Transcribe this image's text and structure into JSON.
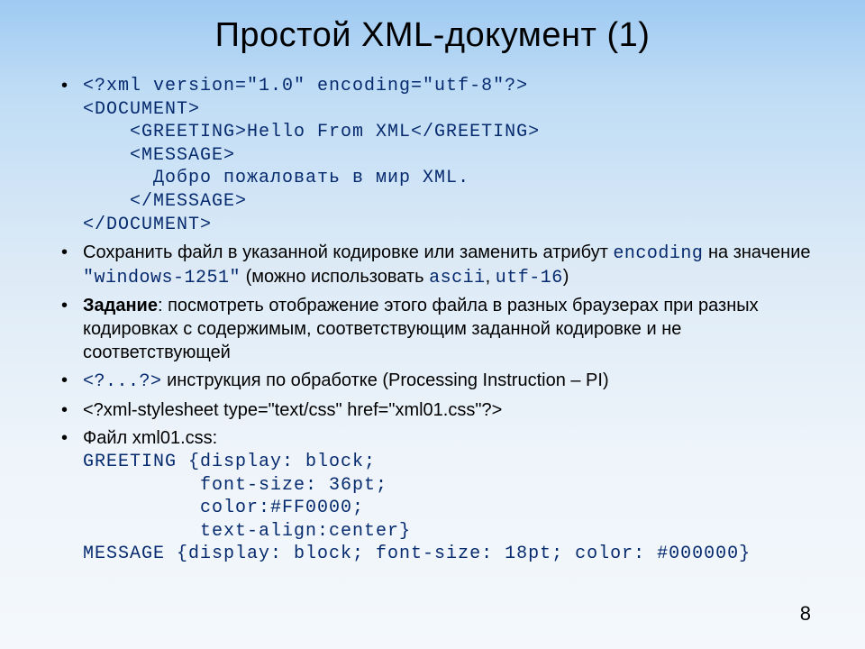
{
  "title": "Простой XML-документ (1)",
  "page_number": "8",
  "bullets": {
    "b1_code": "<?xml version=\"1.0\" encoding=\"utf-8\"?>\n<DOCUMENT>\n    <GREETING>Hello From XML</GREETING>\n    <MESSAGE>\n      Добро пожаловать в мир XML.\n    </MESSAGE>\n</DOCUMENT>",
    "b2_pre": "Сохранить файл в указанной кодировке или заменить атрибут ",
    "b2_code1": "encoding",
    "b2_mid": " на значение ",
    "b2_code2": "\"windows-1251\"",
    "b2_mid2": " (можно использовать ",
    "b2_code3": "ascii",
    "b2_sep": ", ",
    "b2_code4": "utf-16",
    "b2_post": ")",
    "b3_label": "Задание",
    "b3_text": ": посмотреть отображение этого файла в разных браузерах при разных кодировках с содержимым, соответствующим заданной кодировке и не соответствующей",
    "b4_code": "<?...?>",
    "b4_text": " инструкция по обработке (Processing Instruction – PI)",
    "b5_text": "<?xml-stylesheet type=\"text/css\" href=\"xml01.css\"?>",
    "b6_pre": "Файл xml01.css:",
    "b6_code": "GREETING {display: block;\n          font-size: 36pt;\n          color:#FF0000;\n          text-align:center}\nMESSAGE {display: block; font-size: 18pt; color: #000000}"
  }
}
